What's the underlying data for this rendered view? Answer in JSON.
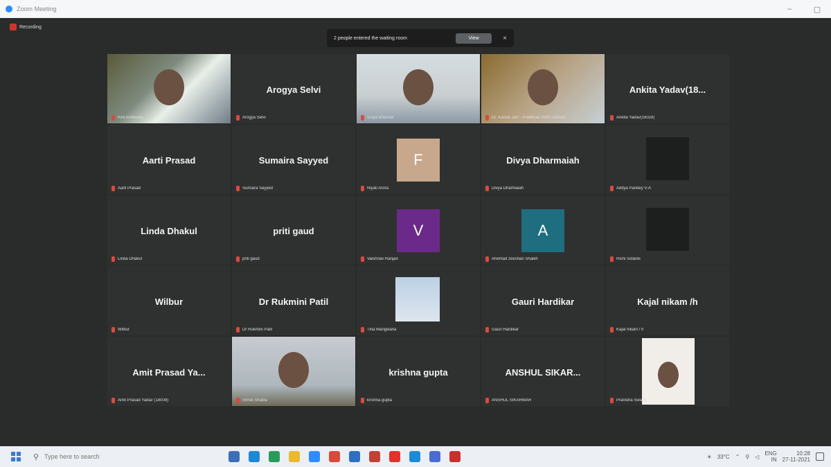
{
  "window": {
    "title": "Zoom Meeting",
    "minimize": "–",
    "maximize": "▢"
  },
  "recording": {
    "label": "Recording"
  },
  "notification": {
    "text": "2 people entered the waiting room",
    "view_label": "View",
    "close": "×"
  },
  "tiles": [
    {
      "type": "video",
      "style": "v1",
      "label": "Kirti Ambwani",
      "active": true
    },
    {
      "type": "name",
      "name": "Arogya Selvi",
      "label": "Arogya Selvi"
    },
    {
      "type": "video",
      "style": "v3",
      "label": "Sulya Bhavsar"
    },
    {
      "type": "video",
      "style": "v4",
      "label": "Dr. Kamal Jain - Pratibhali Vidhi Sadhan"
    },
    {
      "type": "name",
      "name": "Ankita Yadav(18...",
      "label": "Ankita Yadav(18028)"
    },
    {
      "type": "name",
      "name": "Aarti Prasad",
      "label": "Aarti Prasad"
    },
    {
      "type": "name",
      "name": "Sumaira Sayyed",
      "label": "Sumaira Sayyed"
    },
    {
      "type": "letter",
      "letter": "F",
      "color": "f",
      "label": "Niyati Arora"
    },
    {
      "type": "name",
      "name": "Divya Dharmaiah",
      "label": "Divya Dharmaiah"
    },
    {
      "type": "blank",
      "label": "Aditya Pandey V-A"
    },
    {
      "type": "name",
      "name": "Linda Dhakul",
      "label": "Linda Dhakul"
    },
    {
      "type": "name",
      "name": "priti gaud",
      "label": "priti gaud"
    },
    {
      "type": "letter",
      "letter": "V",
      "color": "v",
      "label": "Vaishnav Ranjan"
    },
    {
      "type": "letter",
      "letter": "A",
      "color": "a",
      "label": "Ahemad zeeshan Shaikh"
    },
    {
      "type": "blank",
      "label": "Rishi Solanki"
    },
    {
      "type": "name",
      "name": "Wilbur",
      "label": "Wilbur"
    },
    {
      "type": "name",
      "name": "Dr Rukmini Patil",
      "label": "Dr Rukmini Patil"
    },
    {
      "type": "photo",
      "label": "Tina Mangwana"
    },
    {
      "type": "name",
      "name": "Gauri Hardikar",
      "label": "Gauri Hardikar"
    },
    {
      "type": "name",
      "name": "Kajal  nikam  /h",
      "label": "Kajal  nikam  / h"
    },
    {
      "type": "name",
      "name": "Amit Prasad Ya...",
      "label": "Amit Prasad Yadav (18008)"
    },
    {
      "type": "video",
      "style": "v-video",
      "label": "Shruti Shukla"
    },
    {
      "type": "name",
      "name": "krishna gupta",
      "label": "krishna gupta"
    },
    {
      "type": "name",
      "name": "ANSHUL  SIKAR...",
      "label": "ANSHUL SIKARWAR"
    },
    {
      "type": "portrait",
      "label": "Pranisha Swami"
    }
  ],
  "taskbar": {
    "search_placeholder": "Type here to search",
    "weather": "33°C",
    "lang": "ENG",
    "lang2": "IN",
    "time": "10:28",
    "date": "27-11-2021",
    "icons": [
      {
        "name": "taskview-icon",
        "color": "#3b6fb6"
      },
      {
        "name": "edge-icon",
        "color": "#1f88d6"
      },
      {
        "name": "store-icon",
        "color": "#2a9a5a"
      },
      {
        "name": "explorer-icon",
        "color": "#e8b931"
      },
      {
        "name": "zoom-icon",
        "color": "#2d8cff"
      },
      {
        "name": "paint-icon",
        "color": "#d84a3a"
      },
      {
        "name": "mail-icon",
        "color": "#2f6ec1"
      },
      {
        "name": "photos-icon",
        "color": "#c04035"
      },
      {
        "name": "opera-icon",
        "color": "#e0332b"
      },
      {
        "name": "skype-icon",
        "color": "#1d8ad8"
      },
      {
        "name": "teams-icon",
        "color": "#4a6cd0"
      },
      {
        "name": "record-icon",
        "color": "#c82f2f"
      }
    ]
  }
}
